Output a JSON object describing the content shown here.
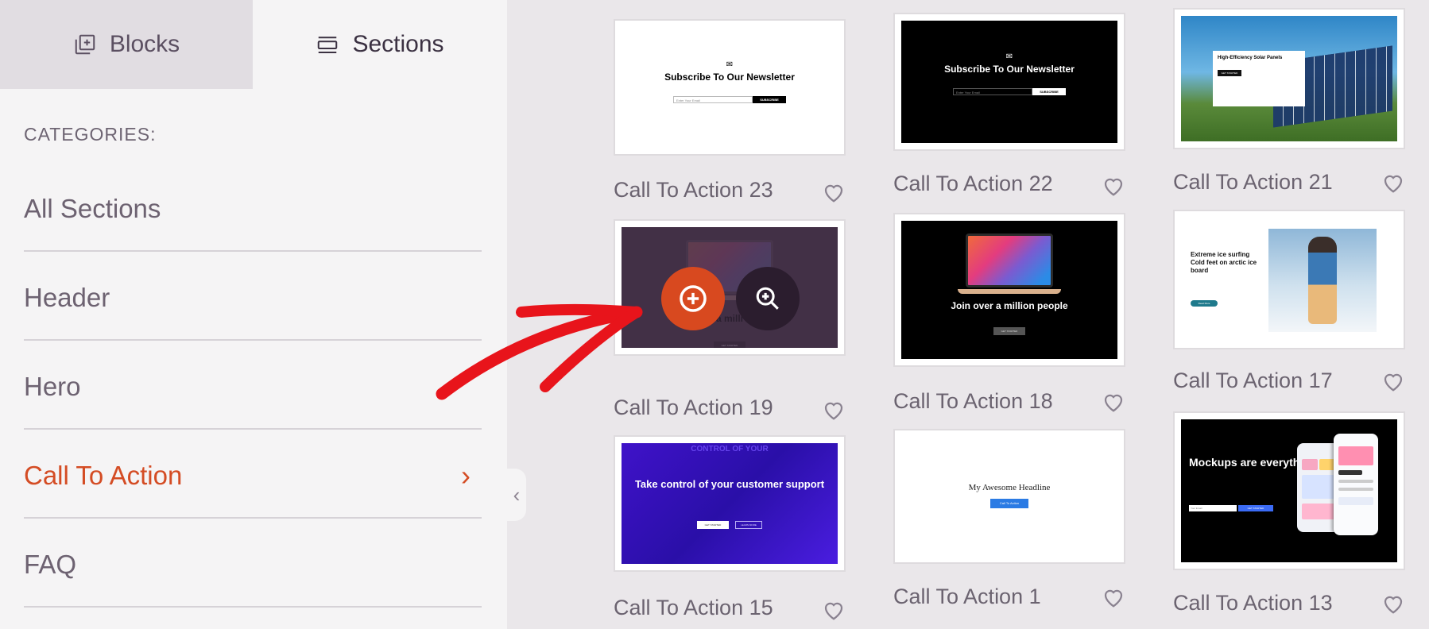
{
  "tabs": {
    "blocks_label": "Blocks",
    "sections_label": "Sections"
  },
  "sidebar": {
    "categories_label": "CATEGORIES:",
    "items": [
      {
        "label": "All Sections"
      },
      {
        "label": "Header"
      },
      {
        "label": "Hero"
      },
      {
        "label": "Call To Action",
        "active": true
      },
      {
        "label": "FAQ"
      }
    ]
  },
  "grid": {
    "cards": [
      {
        "label": "Call To Action 23",
        "thumb": {
          "title": "Subscribe To Our Newsletter",
          "input": "Enter Your Email",
          "button": "SUBSCRIBE"
        }
      },
      {
        "label": "Call To Action 22",
        "thumb": {
          "title": "Subscribe To Our Newsletter",
          "input": "Enter Your Email",
          "button": "SUBSCRIBE"
        }
      },
      {
        "label": "Call To Action 21",
        "thumb": {
          "title": "High-Efficiency Solar Panels",
          "button": "GET STARTED"
        }
      },
      {
        "label": "Call To Action 19",
        "thumb": {
          "title": "a milli",
          "button": "GET STARTED"
        }
      },
      {
        "label": "Call To Action 18",
        "thumb": {
          "title": "Join over a million people",
          "button": "GET STARTED"
        }
      },
      {
        "label": "Call To Action 17",
        "thumb": {
          "title": "Extreme ice surfing Cold feet on arctic ice board",
          "button": "Read More"
        }
      },
      {
        "label": "Call To Action 15",
        "thumb": {
          "top": "CONTROL OF YOUR",
          "title": "Take control of your customer support",
          "button1": "GET STARTED",
          "button2": "LEARN MORE"
        }
      },
      {
        "label": "Call To Action 1",
        "thumb": {
          "title": "My Awesome Headline",
          "button": "Call To Action"
        }
      },
      {
        "label": "Call To Action 13",
        "thumb": {
          "title": "Mockups are everything",
          "input": "Your Email",
          "button": "GET STARTED"
        }
      }
    ]
  },
  "colors": {
    "accent": "#d44c24",
    "add_button": "#d8491f",
    "zoom_button": "#2b1d2e",
    "arrow": "#e8141b"
  }
}
